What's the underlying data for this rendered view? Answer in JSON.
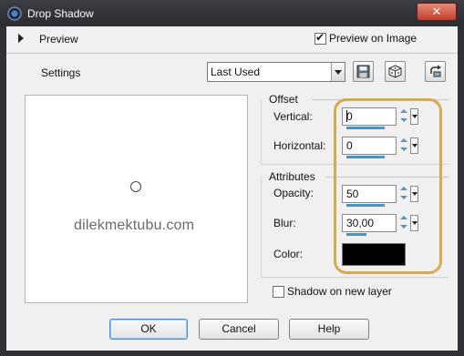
{
  "window": {
    "title": "Drop Shadow",
    "close_glyph": "✕"
  },
  "preview_bar": {
    "label": "Preview",
    "preview_on_image_label": "Preview on Image",
    "preview_on_image_checked": true
  },
  "settings": {
    "label": "Settings",
    "preset_value": "Last Used",
    "tool_icons": [
      "save-preset-icon",
      "random-dice-icon",
      "reset-icon"
    ]
  },
  "preview_area": {
    "watermark": "dilekmektubu.com"
  },
  "offset": {
    "title": "Offset",
    "vertical_label": "Vertical:",
    "vertical_value": "0",
    "horizontal_label": "Horizontal:",
    "horizontal_value": "0"
  },
  "attributes": {
    "title": "Attributes",
    "opacity_label": "Opacity:",
    "opacity_value": "50",
    "blur_label": "Blur:",
    "blur_value": "30,00",
    "color_label": "Color:",
    "color_value": "#000000"
  },
  "options": {
    "shadow_on_new_layer_label": "Shadow on new layer",
    "shadow_on_new_layer_checked": false
  },
  "buttons": {
    "ok": "OK",
    "cancel": "Cancel",
    "help": "Help"
  },
  "colors": {
    "highlight": "#d6aa4f",
    "spin_accent": "#4e93c7",
    "titlebar": "#2f3136"
  }
}
